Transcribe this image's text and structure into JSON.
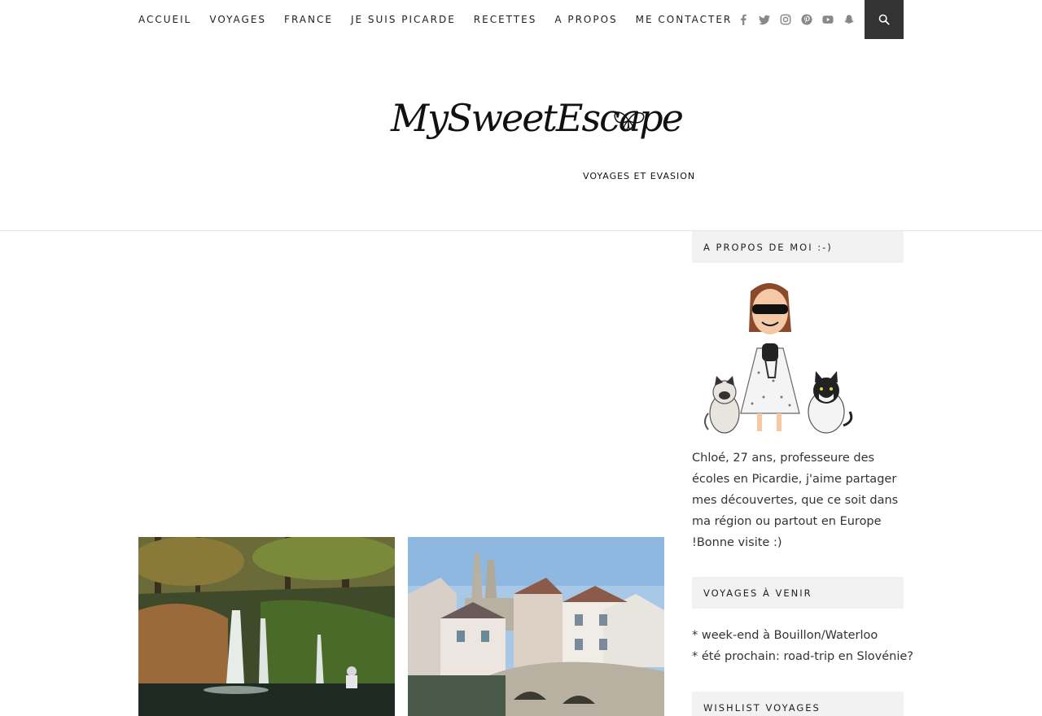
{
  "nav": {
    "items": [
      {
        "label": "ACCUEIL"
      },
      {
        "label": "VOYAGES"
      },
      {
        "label": "FRANCE"
      },
      {
        "label": "JE SUIS PICARDE"
      },
      {
        "label": "RECETTES"
      },
      {
        "label": "A PROPOS"
      },
      {
        "label": "ME CONTACTER"
      }
    ]
  },
  "social": [
    "facebook-icon",
    "twitter-icon",
    "instagram-icon",
    "pinterest-icon",
    "youtube-icon",
    "snapchat-icon"
  ],
  "logo": {
    "title": "MySweetEscape",
    "tagline": "VOYAGES ET EVASION"
  },
  "sidebar": {
    "about_title": "A PROPOS DE MOI :-)",
    "about_text": "Chloé, 27 ans, professeure des écoles en Picardie, j'aime partager mes découvertes, que ce soit dans ma région ou partout en Europe !Bonne visite :)",
    "trips_title": "VOYAGES À VENIR",
    "trips": [
      "* week-end à Bouillon/Waterloo",
      "* été prochain: road-trip en Slovénie?"
    ],
    "wishlist_title": "WISHLIST VOYAGES"
  },
  "colors": {
    "search_bg": "#333333",
    "widget_bg": "#f2f2f2",
    "icon": "#888888"
  }
}
